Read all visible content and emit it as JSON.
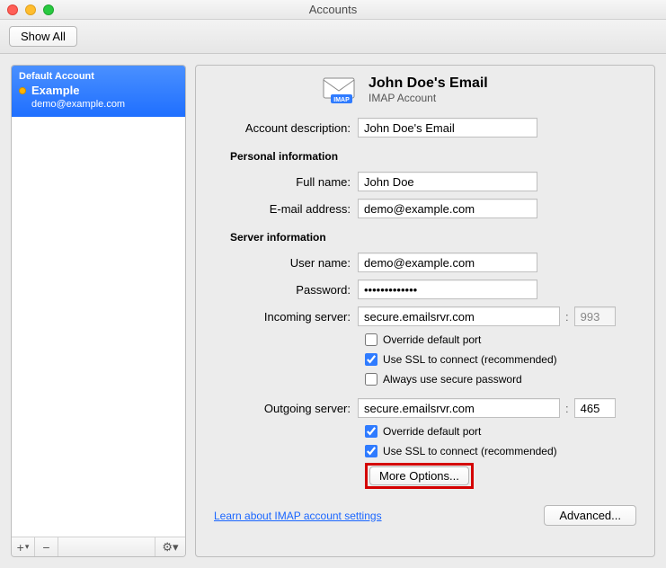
{
  "window": {
    "title": "Accounts"
  },
  "toolbar": {
    "show_all": "Show All"
  },
  "sidebar": {
    "default_label": "Default Account",
    "account": {
      "name": "Example",
      "email": "demo@example.com"
    },
    "footer": {
      "add_label": "+",
      "remove_label": "−",
      "dropdown_label": "▾",
      "gear_label": "⚙▾"
    }
  },
  "header": {
    "title": "John Doe's Email",
    "subtitle": "IMAP Account"
  },
  "labels": {
    "account_description": "Account description:",
    "personal_info": "Personal information",
    "full_name": "Full name:",
    "email": "E-mail address:",
    "server_info": "Server information",
    "user_name": "User name:",
    "password": "Password:",
    "incoming_server": "Incoming server:",
    "outgoing_server": "Outgoing server:",
    "override_port": "Override default port",
    "use_ssl": "Use SSL to connect (recommended)",
    "secure_password": "Always use secure password",
    "more_options": "More Options...",
    "learn_link": "Learn about IMAP account settings",
    "advanced": "Advanced...",
    "port_colon": ":"
  },
  "values": {
    "account_description": "John Doe's Email",
    "full_name": "John Doe",
    "email": "demo@example.com",
    "user_name": "demo@example.com",
    "password": "•••••••••••••",
    "incoming_server": "secure.emailsrvr.com",
    "incoming_port": "993",
    "outgoing_server": "secure.emailsrvr.com",
    "outgoing_port": "465",
    "incoming_override": false,
    "incoming_ssl": true,
    "incoming_securepw": false,
    "outgoing_override": true,
    "outgoing_ssl": true
  }
}
